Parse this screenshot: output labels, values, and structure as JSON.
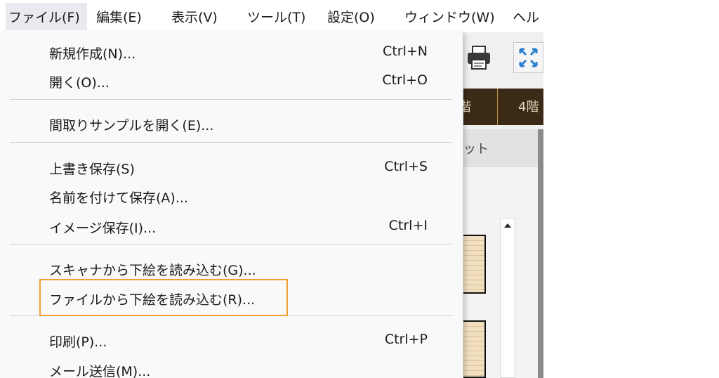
{
  "menubar": {
    "items": [
      {
        "label": "ファイル(F)"
      },
      {
        "label": "編集(E)"
      },
      {
        "label": "表示(V)"
      },
      {
        "label": "ツール(T)"
      },
      {
        "label": "設定(O)"
      },
      {
        "label": "ウィンドウ(W)"
      },
      {
        "label": "ヘル"
      }
    ]
  },
  "toolbar": {
    "icons": [
      "printer-icon",
      "fit-to-screen-icon"
    ]
  },
  "floor_tabs": {
    "items": [
      {
        "label": "階"
      },
      {
        "label": "4階"
      }
    ]
  },
  "panel": {
    "header_label": "ット"
  },
  "file_menu": {
    "items": [
      {
        "label": "新規作成(N)...",
        "shortcut": "Ctrl+N"
      },
      {
        "label": "開く(O)...",
        "shortcut": "Ctrl+O"
      },
      {
        "label": "間取りサンプルを開く(E)...",
        "shortcut": ""
      },
      {
        "label": "上書き保存(S)",
        "shortcut": "Ctrl+S"
      },
      {
        "label": "名前を付けて保存(A)...",
        "shortcut": ""
      },
      {
        "label": "イメージ保存(I)...",
        "shortcut": "Ctrl+I"
      },
      {
        "label": "スキャナから下絵を読み込む(G)...",
        "shortcut": ""
      },
      {
        "label": "ファイルから下絵を読み込む(R)...",
        "shortcut": ""
      },
      {
        "label": "印刷(P)...",
        "shortcut": "Ctrl+P"
      },
      {
        "label": "メール送信(M)...",
        "shortcut": ""
      }
    ]
  },
  "colors": {
    "highlight_border": "#f0a030",
    "floor_strip_bg": "#3b2a16",
    "floor_strip_separator": "#c7963f",
    "tile_fill": "#f2dfc0"
  }
}
